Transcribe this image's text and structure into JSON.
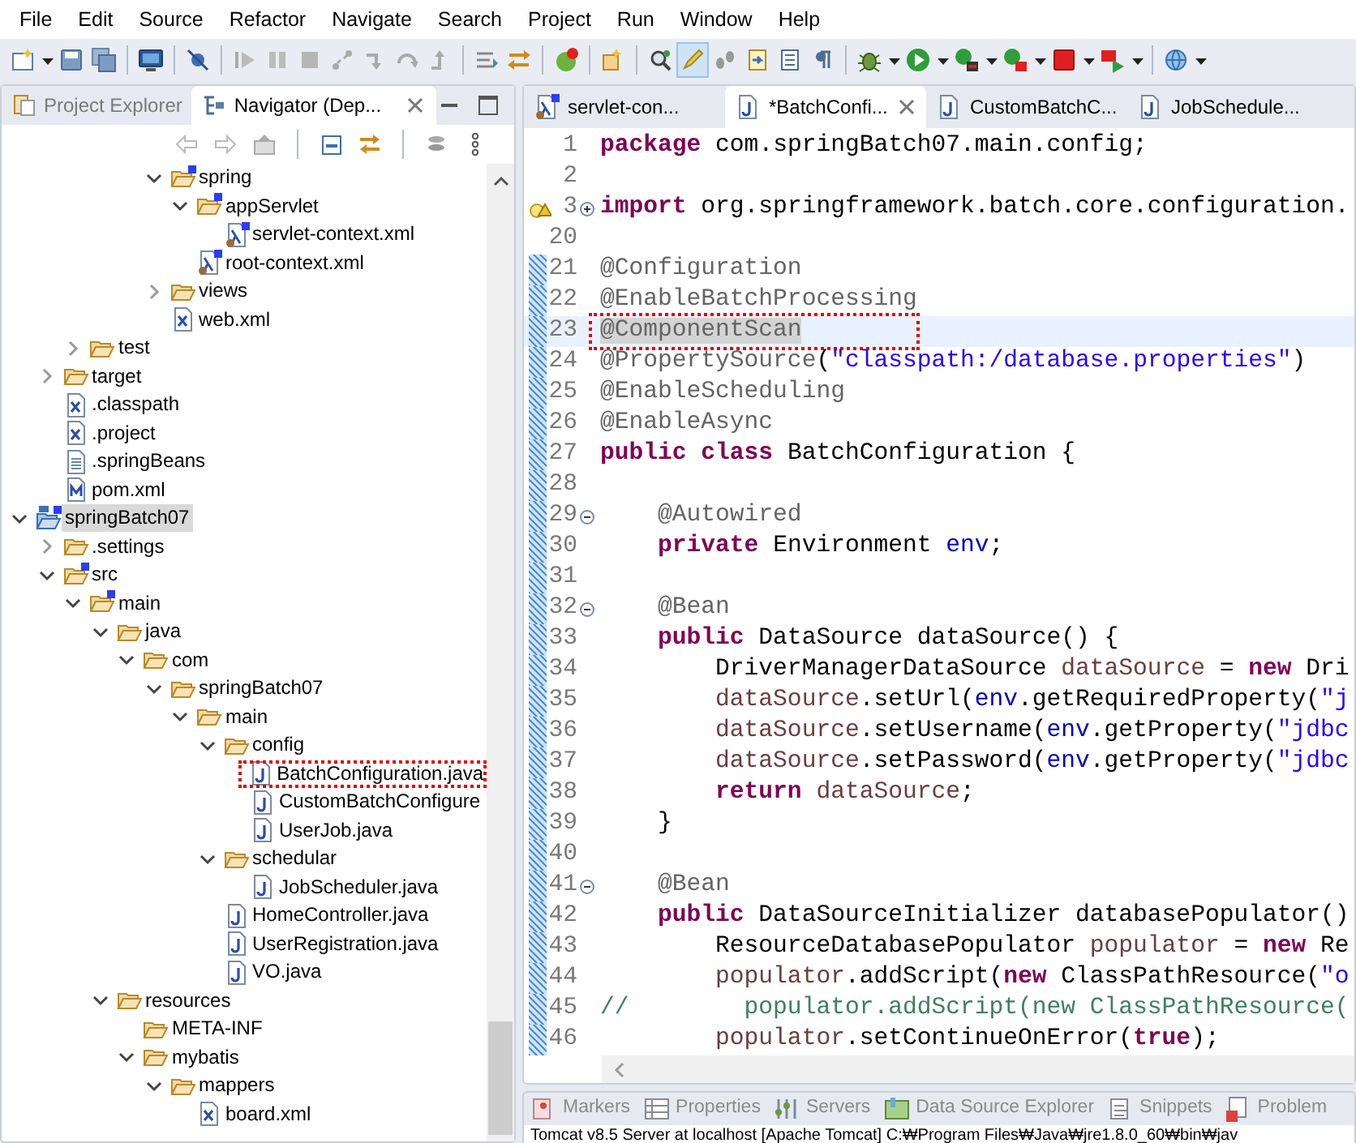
{
  "menu": [
    "File",
    "Edit",
    "Source",
    "Refactor",
    "Navigate",
    "Search",
    "Project",
    "Run",
    "Window",
    "Help"
  ],
  "toolbar": [
    {
      "kind": "new",
      "pressed": false
    },
    {
      "kind": "caret",
      "pressed": false
    },
    {
      "kind": "save",
      "pressed": false
    },
    {
      "kind": "save-all",
      "pressed": false
    },
    {
      "kind": "sep"
    },
    {
      "kind": "terminal",
      "pressed": false
    },
    {
      "kind": "sep"
    },
    {
      "kind": "skip-breakpoints",
      "pressed": false
    },
    {
      "kind": "sep"
    },
    {
      "kind": "resume",
      "pressed": false
    },
    {
      "kind": "suspend",
      "pressed": false
    },
    {
      "kind": "terminate",
      "pressed": false
    },
    {
      "kind": "disconnect",
      "pressed": false
    },
    {
      "kind": "step-into",
      "pressed": false
    },
    {
      "kind": "step-over",
      "pressed": false
    },
    {
      "kind": "step-return",
      "pressed": false
    },
    {
      "kind": "sep"
    },
    {
      "kind": "step-filters",
      "pressed": false
    },
    {
      "kind": "drop-frame",
      "pressed": false
    },
    {
      "kind": "sep"
    },
    {
      "kind": "spring-update",
      "pressed": false
    },
    {
      "kind": "sep"
    },
    {
      "kind": "open-type",
      "pressed": false
    },
    {
      "kind": "sep"
    },
    {
      "kind": "task-search",
      "pressed": false
    },
    {
      "kind": "highlighter",
      "pressed": true
    },
    {
      "kind": "footprints",
      "pressed": false
    },
    {
      "kind": "tasks",
      "pressed": false
    },
    {
      "kind": "block",
      "pressed": false
    },
    {
      "kind": "pilcrow",
      "pressed": false
    },
    {
      "kind": "sep"
    },
    {
      "kind": "debug",
      "pressed": false
    },
    {
      "kind": "caret",
      "pressed": false
    },
    {
      "kind": "run",
      "pressed": false
    },
    {
      "kind": "caret",
      "pressed": false
    },
    {
      "kind": "run-last",
      "pressed": false
    },
    {
      "kind": "caret",
      "pressed": false
    },
    {
      "kind": "coverage",
      "pressed": false
    },
    {
      "kind": "caret",
      "pressed": false
    },
    {
      "kind": "stop",
      "pressed": false
    },
    {
      "kind": "caret",
      "pressed": false
    },
    {
      "kind": "run-server",
      "pressed": false
    },
    {
      "kind": "caret",
      "pressed": false
    },
    {
      "kind": "sep"
    },
    {
      "kind": "globe",
      "pressed": false
    },
    {
      "kind": "caret",
      "pressed": false
    }
  ],
  "left_panel": {
    "tabs": [
      {
        "label": "Project Explorer",
        "selected": false
      },
      {
        "label": "Navigator (Dep...",
        "selected": true
      }
    ],
    "tree": [
      {
        "children": [
          {
            "children": [
              {
                "children": [
                  {
                    "children": [
                      {
                        "children": [
                          {
                            "label": "spring",
                            "kind": "spring-folder",
                            "expanded": true,
                            "selected": false,
                            "marked": false,
                            "children": [
                              {
                                "label": "appServlet",
                                "kind": "spring-folder",
                                "expanded": true,
                                "selected": false,
                                "marked": false,
                                "children": [
                                  {
                                    "label": "servlet-context.xml",
                                    "kind": "spring-xml",
                                    "selected": false,
                                    "marked": false
                                  }
                                ]
                              },
                              {
                                "label": "root-context.xml",
                                "kind": "spring-xml",
                                "selected": false,
                                "marked": false
                              }
                            ]
                          },
                          {
                            "label": "views",
                            "kind": "folder",
                            "expanded": false,
                            "selected": false,
                            "marked": false
                          },
                          {
                            "label": "web.xml",
                            "kind": "xml",
                            "selected": false,
                            "marked": false
                          }
                        ]
                      }
                    ]
                  }
                ]
              },
              {
                "label": "test",
                "kind": "folder",
                "expanded": false,
                "selected": false,
                "marked": false
              }
            ]
          },
          {
            "label": "target",
            "kind": "folder",
            "expanded": false,
            "selected": false,
            "marked": false
          },
          {
            "label": ".classpath",
            "kind": "xml",
            "selected": false,
            "marked": false
          },
          {
            "label": ".project",
            "kind": "xml",
            "selected": false,
            "marked": false
          },
          {
            "label": ".springBeans",
            "kind": "text",
            "selected": false,
            "marked": false
          },
          {
            "label": "pom.xml",
            "kind": "maven",
            "selected": false,
            "marked": false
          }
        ]
      },
      {
        "label": "springBatch07",
        "kind": "project",
        "expanded": true,
        "selected": true,
        "marked": false,
        "children": [
          {
            "label": ".settings",
            "kind": "folder",
            "expanded": false,
            "selected": false,
            "marked": false
          },
          {
            "label": "src",
            "kind": "spring-folder",
            "expanded": true,
            "selected": false,
            "marked": false,
            "children": [
              {
                "label": "main",
                "kind": "spring-folder",
                "expanded": true,
                "selected": false,
                "marked": false,
                "children": [
                  {
                    "label": "java",
                    "kind": "folder",
                    "expanded": true,
                    "selected": false,
                    "marked": false,
                    "children": [
                      {
                        "label": "com",
                        "kind": "folder",
                        "expanded": true,
                        "selected": false,
                        "marked": false,
                        "children": [
                          {
                            "label": "springBatch07",
                            "kind": "folder",
                            "expanded": true,
                            "selected": false,
                            "marked": false,
                            "children": [
                              {
                                "label": "main",
                                "kind": "folder",
                                "expanded": true,
                                "selected": false,
                                "marked": false,
                                "children": [
                                  {
                                    "label": "config",
                                    "kind": "folder",
                                    "expanded": true,
                                    "selected": false,
                                    "marked": false,
                                    "children": [
                                      {
                                        "label": "BatchConfiguration.java",
                                        "kind": "java",
                                        "selected": false,
                                        "marked": true
                                      },
                                      {
                                        "label": "CustomBatchConfigure",
                                        "kind": "java",
                                        "selected": false,
                                        "marked": false
                                      },
                                      {
                                        "label": "UserJob.java",
                                        "kind": "java",
                                        "selected": false,
                                        "marked": false
                                      }
                                    ]
                                  },
                                  {
                                    "label": "schedular",
                                    "kind": "folder",
                                    "expanded": true,
                                    "selected": false,
                                    "marked": false,
                                    "children": [
                                      {
                                        "label": "JobScheduler.java",
                                        "kind": "java",
                                        "selected": false,
                                        "marked": false
                                      }
                                    ]
                                  },
                                  {
                                    "label": "HomeController.java",
                                    "kind": "java",
                                    "selected": false,
                                    "marked": false
                                  },
                                  {
                                    "label": "UserRegistration.java",
                                    "kind": "java",
                                    "selected": false,
                                    "marked": false
                                  },
                                  {
                                    "label": "VO.java",
                                    "kind": "java",
                                    "selected": false,
                                    "marked": false
                                  }
                                ]
                              }
                            ]
                          }
                        ]
                      }
                    ]
                  },
                  {
                    "label": "resources",
                    "kind": "folder",
                    "expanded": true,
                    "selected": false,
                    "marked": false,
                    "children": [
                      {
                        "label": "META-INF",
                        "kind": "folder",
                        "selected": false,
                        "marked": false
                      },
                      {
                        "label": "mybatis",
                        "kind": "folder",
                        "expanded": true,
                        "selected": false,
                        "marked": false,
                        "children": [
                          {
                            "label": "mappers",
                            "kind": "folder",
                            "expanded": true,
                            "selected": false,
                            "marked": false,
                            "children": [
                              {
                                "label": "board.xml",
                                "kind": "xml",
                                "selected": false,
                                "marked": false
                              }
                            ]
                          }
                        ]
                      }
                    ]
                  }
                ]
              }
            ]
          }
        ]
      }
    ]
  },
  "editor": {
    "tabs": [
      {
        "label": "servlet-con...",
        "kind": "spring-xml",
        "selected": false
      },
      {
        "label": "*BatchConfi...",
        "kind": "java",
        "selected": true
      },
      {
        "label": "CustomBatchC...",
        "kind": "java",
        "selected": false
      },
      {
        "label": "JobSchedule...",
        "kind": "java",
        "selected": false
      }
    ],
    "lines": [
      {
        "num": "1",
        "changed": false,
        "current": false,
        "marked": false,
        "warning": false,
        "tokens": [
          {
            "kind": "kw",
            "text": "package"
          },
          {
            "kind": "plain",
            "text": " com.springBatch07.main.config;"
          }
        ]
      },
      {
        "num": "2",
        "changed": false,
        "current": false,
        "marked": false,
        "warning": false
      },
      {
        "num": "3",
        "changed": false,
        "current": false,
        "marked": false,
        "warning": true,
        "collapsed": true,
        "tokens": [
          {
            "kind": "kw",
            "text": "import"
          },
          {
            "kind": "plain",
            "text": " org.springframework.batch.core.configuration."
          }
        ]
      },
      {
        "num": "20",
        "changed": false,
        "current": false,
        "marked": false,
        "warning": false
      },
      {
        "num": "21",
        "changed": true,
        "current": false,
        "marked": false,
        "warning": false,
        "tokens": [
          {
            "kind": "ann",
            "text": "@Configuration"
          }
        ]
      },
      {
        "num": "22",
        "changed": true,
        "current": false,
        "marked": false,
        "warning": false,
        "tokens": [
          {
            "kind": "ann",
            "text": "@EnableBatchProcessing"
          }
        ]
      },
      {
        "num": "23",
        "changed": true,
        "current": true,
        "marked": true,
        "warning": false,
        "tokens": [
          {
            "kind": "ann-hl",
            "text": "@ComponentScan"
          }
        ]
      },
      {
        "num": "24",
        "changed": true,
        "current": false,
        "marked": false,
        "warning": false,
        "tokens": [
          {
            "kind": "ann",
            "text": "@PropertySource"
          },
          {
            "kind": "plain",
            "text": "("
          },
          {
            "kind": "str",
            "text": "\"classpath:/database.properties\""
          },
          {
            "kind": "plain",
            "text": ")"
          }
        ]
      },
      {
        "num": "25",
        "changed": true,
        "current": false,
        "marked": false,
        "warning": false,
        "tokens": [
          {
            "kind": "ann",
            "text": "@EnableScheduling"
          }
        ]
      },
      {
        "num": "26",
        "changed": true,
        "current": false,
        "marked": false,
        "warning": false,
        "tokens": [
          {
            "kind": "ann",
            "text": "@EnableAsync"
          }
        ]
      },
      {
        "num": "27",
        "changed": true,
        "current": false,
        "marked": false,
        "warning": false,
        "tokens": [
          {
            "kind": "kw",
            "text": "public"
          },
          {
            "kind": "kw",
            "text": " class"
          },
          {
            "kind": "plain",
            "text": " BatchConfiguration {"
          }
        ]
      },
      {
        "num": "28",
        "changed": true,
        "current": false,
        "marked": false,
        "warning": false
      },
      {
        "num": "29",
        "changed": true,
        "current": false,
        "marked": false,
        "warning": false,
        "collapsed": false,
        "tokens": [
          {
            "kind": "ann",
            "text": "    @Autowired"
          }
        ]
      },
      {
        "num": "30",
        "changed": true,
        "current": false,
        "marked": false,
        "warning": false,
        "tokens": [
          {
            "kind": "kw",
            "text": "    private"
          },
          {
            "kind": "plain",
            "text": " Environment "
          },
          {
            "kind": "field",
            "text": "env"
          },
          {
            "kind": "plain",
            "text": ";"
          }
        ]
      },
      {
        "num": "31",
        "changed": true,
        "current": false,
        "marked": false,
        "warning": false
      },
      {
        "num": "32",
        "changed": true,
        "current": false,
        "marked": false,
        "warning": false,
        "collapsed": false,
        "tokens": [
          {
            "kind": "ann",
            "text": "    @Bean"
          }
        ]
      },
      {
        "num": "33",
        "changed": true,
        "current": false,
        "marked": false,
        "warning": false,
        "tokens": [
          {
            "kind": "kw",
            "text": "    public"
          },
          {
            "kind": "plain",
            "text": " DataSource dataSource() {"
          }
        ]
      },
      {
        "num": "34",
        "changed": true,
        "current": false,
        "marked": false,
        "warning": false,
        "tokens": [
          {
            "kind": "plain",
            "text": "        DriverManagerDataSource "
          },
          {
            "kind": "local",
            "text": "dataSource"
          },
          {
            "kind": "plain",
            "text": " = "
          },
          {
            "kind": "kw",
            "text": "new"
          },
          {
            "kind": "plain",
            "text": " Dri"
          }
        ]
      },
      {
        "num": "35",
        "changed": true,
        "current": false,
        "marked": false,
        "warning": false,
        "tokens": [
          {
            "kind": "local",
            "text": "        dataSource"
          },
          {
            "kind": "plain",
            "text": ".setUrl("
          },
          {
            "kind": "field",
            "text": "env"
          },
          {
            "kind": "plain",
            "text": ".getRequiredProperty("
          },
          {
            "kind": "str",
            "text": "\"j"
          }
        ]
      },
      {
        "num": "36",
        "changed": true,
        "current": false,
        "marked": false,
        "warning": false,
        "tokens": [
          {
            "kind": "local",
            "text": "        dataSource"
          },
          {
            "kind": "plain",
            "text": ".setUsername("
          },
          {
            "kind": "field",
            "text": "env"
          },
          {
            "kind": "plain",
            "text": ".getProperty("
          },
          {
            "kind": "str",
            "text": "\"jdbc"
          }
        ]
      },
      {
        "num": "37",
        "changed": true,
        "current": false,
        "marked": false,
        "warning": false,
        "tokens": [
          {
            "kind": "local",
            "text": "        dataSource"
          },
          {
            "kind": "plain",
            "text": ".setPassword("
          },
          {
            "kind": "field",
            "text": "env"
          },
          {
            "kind": "plain",
            "text": ".getProperty("
          },
          {
            "kind": "str",
            "text": "\"jdbc"
          }
        ]
      },
      {
        "num": "38",
        "changed": true,
        "current": false,
        "marked": false,
        "warning": false,
        "tokens": [
          {
            "kind": "kw",
            "text": "        return"
          },
          {
            "kind": "local",
            "text": " dataSource"
          },
          {
            "kind": "plain",
            "text": ";"
          }
        ]
      },
      {
        "num": "39",
        "changed": true,
        "current": false,
        "marked": false,
        "warning": false,
        "tokens": [
          {
            "kind": "plain",
            "text": "    }"
          }
        ]
      },
      {
        "num": "40",
        "changed": true,
        "current": false,
        "marked": false,
        "warning": false
      },
      {
        "num": "41",
        "changed": true,
        "current": false,
        "marked": false,
        "warning": false,
        "collapsed": false,
        "tokens": [
          {
            "kind": "ann",
            "text": "    @Bean"
          }
        ]
      },
      {
        "num": "42",
        "changed": true,
        "current": false,
        "marked": false,
        "warning": false,
        "tokens": [
          {
            "kind": "kw",
            "text": "    public"
          },
          {
            "kind": "plain",
            "text": " DataSourceInitializer databasePopulator()"
          }
        ]
      },
      {
        "num": "43",
        "changed": true,
        "current": false,
        "marked": false,
        "warning": false,
        "tokens": [
          {
            "kind": "plain",
            "text": "        ResourceDatabasePopulator "
          },
          {
            "kind": "local",
            "text": "populator"
          },
          {
            "kind": "plain",
            "text": " = "
          },
          {
            "kind": "kw",
            "text": "new"
          },
          {
            "kind": "plain",
            "text": " Re"
          }
        ]
      },
      {
        "num": "44",
        "changed": true,
        "current": false,
        "marked": false,
        "warning": false,
        "tokens": [
          {
            "kind": "local",
            "text": "        populator"
          },
          {
            "kind": "plain",
            "text": ".addScript("
          },
          {
            "kind": "kw",
            "text": "new"
          },
          {
            "kind": "plain",
            "text": " ClassPathResource("
          },
          {
            "kind": "str",
            "text": "\"o"
          }
        ]
      },
      {
        "num": "45",
        "changed": true,
        "current": false,
        "marked": false,
        "warning": false,
        "tokens": [
          {
            "kind": "comment",
            "text": "//        populator.addScript(new ClassPathResource("
          }
        ]
      },
      {
        "num": "46",
        "changed": true,
        "current": false,
        "marked": false,
        "warning": false,
        "tokens": [
          {
            "kind": "local",
            "text": "        populator"
          },
          {
            "kind": "plain",
            "text": ".setContinueOnError("
          },
          {
            "kind": "kw",
            "text": "true"
          },
          {
            "kind": "plain",
            "text": ");"
          }
        ]
      }
    ]
  },
  "bottom_panel": {
    "tabs": [
      {
        "label": "Markers",
        "kind": "markers"
      },
      {
        "label": "Properties",
        "kind": "properties"
      },
      {
        "label": "Servers",
        "kind": "servers"
      },
      {
        "label": "Data Source Explorer",
        "kind": "datasource"
      },
      {
        "label": "Snippets",
        "kind": "snippets"
      },
      {
        "label": "Problem",
        "kind": "problems"
      }
    ],
    "console_text": "Tomcat v8.5 Server at localhost [Apache Tomcat] C:₩Program Files₩Java₩jre1.8.0_60₩bin₩jav"
  }
}
